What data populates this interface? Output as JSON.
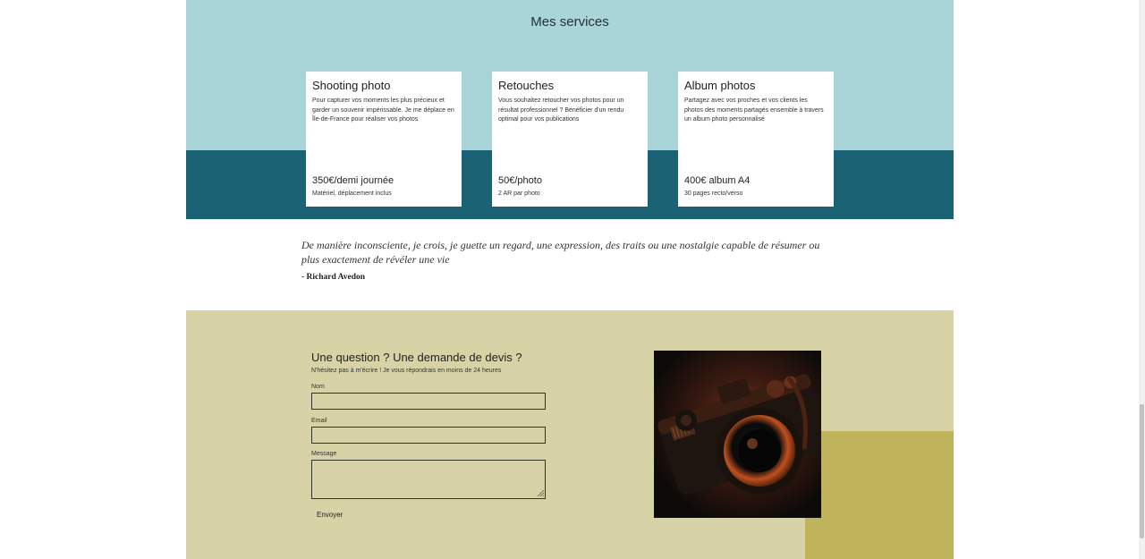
{
  "services": {
    "title": "Mes services",
    "cards": [
      {
        "title": "Shooting photo",
        "description": "Pour capturer vos moments les plus précieux et garder un souvenir impérissable. Je me déplace en Île-de-France pour réaliser vos photos",
        "price": "350€/demi journée",
        "note": "Matériel, déplacement inclus"
      },
      {
        "title": "Retouches",
        "description": "Vous souhaitez retoucher vos photos pour un résultat professionnel ? Bénéficier d'un rendu optimal pour vos publications",
        "price": "50€/photo",
        "note": "2 AR par photo"
      },
      {
        "title": "Album photos",
        "description": "Partagez avec vos proches et vos clients les photos des moments partagés ensemble à travers un album photo personnalisé",
        "price": "400€ album A4",
        "note": "30 pages recto/verso"
      }
    ]
  },
  "quote": {
    "text": "De manière inconsciente, je crois, je guette un regard, une expression, des traits ou une nostalgie capable de résumer ou plus exactement de révéler une vie",
    "author": "- Richard Avedon"
  },
  "contact": {
    "title": "Une question ? Une demande de devis ?",
    "subtitle": "N'hésitez pas à m'écrire ! Je vous répondrais en moins de 24 heures",
    "fields": {
      "name_label": "Nom",
      "name_value": "",
      "email_label": "Email",
      "email_value": "",
      "message_label": "Message",
      "message_value": ""
    },
    "submit_label": "Envoyer"
  },
  "colors": {
    "services_bg": "#a9d5d8",
    "services_band": "#1b6275",
    "contact_bg": "#d7d3a6",
    "contact_accent": "#bfb45b"
  },
  "icons": {
    "textarea_grip": "resize-grip-icon",
    "photo": "camera-photo"
  }
}
